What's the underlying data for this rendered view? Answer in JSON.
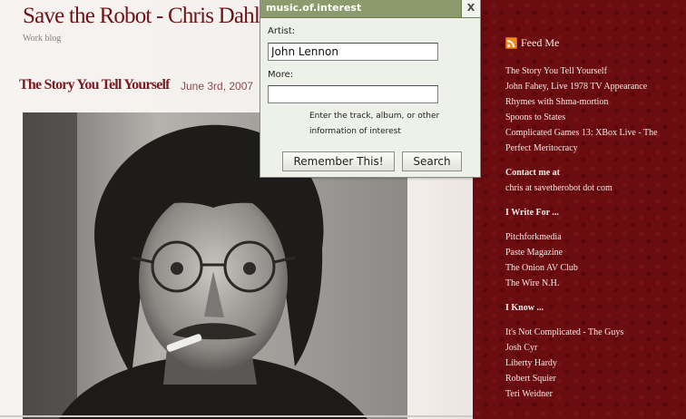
{
  "blog": {
    "title": "Save the Robot - Chris Dahl",
    "tagline": "Work blog"
  },
  "post": {
    "title": "The Story You Tell Yourself",
    "date": "June 3rd, 2007"
  },
  "popup": {
    "title": "music.of.interest",
    "close_label": "X",
    "artist_label": "Artist:",
    "artist_value": "John Lennon",
    "more_label": "More:",
    "more_value": "",
    "hint": "Enter the track, album, or other information of interest",
    "remember_button": "Remember This!",
    "search_button": "Search"
  },
  "sidebar": {
    "feed_label": "Feed Me",
    "recent_posts": [
      "The Story You Tell Yourself",
      "John Fahey, Live 1978 TV Appearance",
      "Rhymes with Shma-mortion",
      "Spoons to States",
      "Complicated Games 13: XBox Live - The",
      "Perfect Meritocracy"
    ],
    "contact_heading": "Contact me at",
    "contact_value": "chris at savetherobot dot com",
    "write_heading": "I Write For ...",
    "write_items": [
      "Pitchforkmedia",
      "Paste Magazine",
      "The Onion AV Club",
      "The Wire N.H."
    ],
    "know_heading": "I Know ...",
    "know_items": [
      "It's Not Complicated - The Guys",
      "Josh Cyr",
      "Liberty Hardy",
      "Robert Squier",
      "Teri Weidner"
    ]
  },
  "colors": {
    "title_red": "#6e1418",
    "sidebar_bg": "#6b0d10",
    "popup_bar": "#8c9b6b"
  }
}
